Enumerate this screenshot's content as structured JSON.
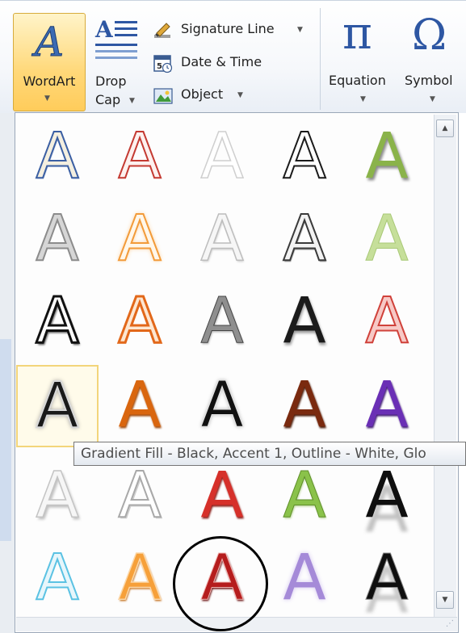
{
  "ribbon": {
    "wordart_label": "WordArt",
    "dropcap_line1": "Drop",
    "dropcap_line2": "Cap",
    "signature_label": "Signature Line",
    "datetime_label": "Date & Time",
    "object_label": "Object",
    "equation_label": "Equation",
    "symbol_label": "Symbol",
    "equation_glyph": "π",
    "symbol_glyph": "Ω"
  },
  "gallery": {
    "letter": "A",
    "styles": [
      [
        "fill-white-outline-accent1",
        "fill-none-outline-accent2",
        "fill-white-warm-matte",
        "fill-none-outline-text1",
        "fill-olive-gradient"
      ],
      [
        "fill-gray-outline",
        "fill-white-outline-orange-glow",
        "fill-white-soft",
        "fill-white-outline-dark",
        "fill-lightgreen"
      ],
      [
        "fill-white-outline-black-bevel",
        "fill-orange-outline",
        "fill-gray-gradient-chrome",
        "fill-black-gradient",
        "fill-pink-outline-red"
      ],
      [
        "gradient-fill-black-glow-selected",
        "fill-orange-gradient",
        "fill-black-white-glow",
        "fill-brown-gradient",
        "fill-purple-gradient"
      ],
      [
        "fill-white-shadow",
        "fill-white-gray-outline",
        "fill-red-gradient",
        "fill-green-gradient",
        "fill-black-reflection"
      ],
      [
        "fill-lightblue-outline",
        "fill-orange-bevel",
        "fill-darkred-circled",
        "fill-lavender-soft",
        "fill-black-reflection-2"
      ]
    ],
    "tooltip": "Gradient Fill - Black, Accent 1, Outline - White, Glo"
  },
  "colors": {
    "accent_wordart": "#ffd879",
    "tooltip_text": "#4c4c4c",
    "gallery_border": "#9aa7b8"
  }
}
